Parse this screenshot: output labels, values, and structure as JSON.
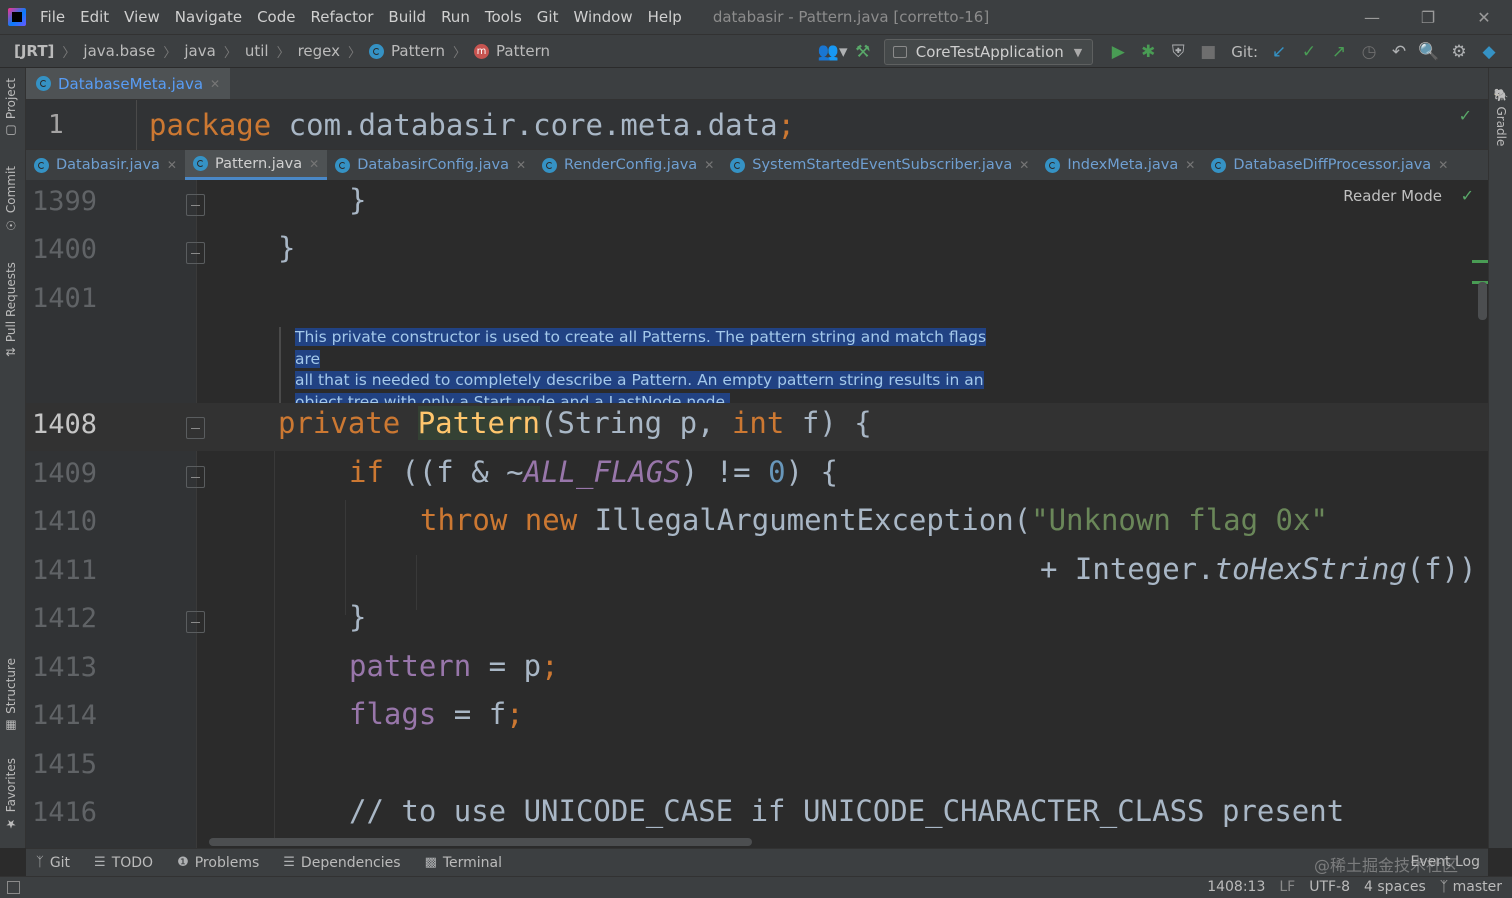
{
  "window": {
    "menu": [
      "File",
      "Edit",
      "View",
      "Navigate",
      "Code",
      "Refactor",
      "Build",
      "Run",
      "Tools",
      "Git",
      "Window",
      "Help"
    ],
    "title": "databasir - Pattern.java [corretto-16]"
  },
  "navbar": {
    "breadcrumbs": [
      "[JRT]",
      "java.base",
      "java",
      "util",
      "regex",
      "Pattern",
      "Pattern"
    ],
    "run_config": "CoreTestApplication",
    "git_label": "Git:"
  },
  "side_tools": {
    "left": [
      "Project",
      "Commit",
      "Pull Requests",
      "Structure",
      "Favorites"
    ],
    "right": [
      "Gradle"
    ]
  },
  "top_tab": {
    "label": "DatabaseMeta.java"
  },
  "pinned_line": {
    "number": "1",
    "keyword": "package",
    "text": " com.databasir.core.meta.data",
    "semi": ";"
  },
  "tabs": [
    {
      "label": "Databasir.java"
    },
    {
      "label": "Pattern.java"
    },
    {
      "label": "DatabasirConfig.java"
    },
    {
      "label": "RenderConfig.java"
    },
    {
      "label": "SystemStartedEventSubscriber.java"
    },
    {
      "label": "IndexMeta.java"
    },
    {
      "label": "DatabaseDiffProcessor.java"
    }
  ],
  "editor": {
    "reader_mode": "Reader Mode",
    "line_numbers": [
      "1399",
      "1400",
      "1401",
      "1408",
      "1409",
      "1410",
      "1411",
      "1412",
      "1413",
      "1414",
      "1415",
      "1416"
    ],
    "doc_lines": [
      "This private constructor is used to create all Patterns. The pattern string and match flags are",
      "all that is needed to completely describe a Pattern. An empty pattern string results in an",
      "object tree with only a Start node and a LastNode node."
    ],
    "code": {
      "l1399": "}",
      "l1400": "}",
      "l1408_kw": "private",
      "l1408_fn": "Pattern",
      "l1408_a": "(String p, ",
      "l1408_kw2": "int",
      "l1408_b": " f) {",
      "l1409_kw": "if",
      "l1409_a": " ((f & ~",
      "l1409_const": "ALL_FLAGS",
      "l1409_b": ") != ",
      "l1409_num": "0",
      "l1409_c": ") {",
      "l1410_kw1": "throw",
      "l1410_kw2": "new",
      "l1410_a": " IllegalArgumentException(",
      "l1410_str": "\"Unknown flag 0x\"",
      "l1411_a": "+ Integer.",
      "l1411_m": "toHexString",
      "l1411_b": "(f))",
      "l1412": "}",
      "l1413_fld": "pattern",
      "l1413_a": " = p",
      "l1413_semi": ";",
      "l1414_fld": "flags",
      "l1414_a": " = f",
      "l1414_semi": ";",
      "l1416_cmt": "// to use UNICODE_CASE if UNICODE_CHARACTER_CLASS present"
    }
  },
  "bottom_tools": [
    "Git",
    "TODO",
    "Problems",
    "Dependencies",
    "Terminal"
  ],
  "event_log": "Event Log",
  "watermark": "@稀土掘金技术社区",
  "status": {
    "position": "1408:13",
    "line_sep": "LF",
    "encoding": "UTF-8",
    "indent": "4 spaces",
    "branch": "master"
  }
}
